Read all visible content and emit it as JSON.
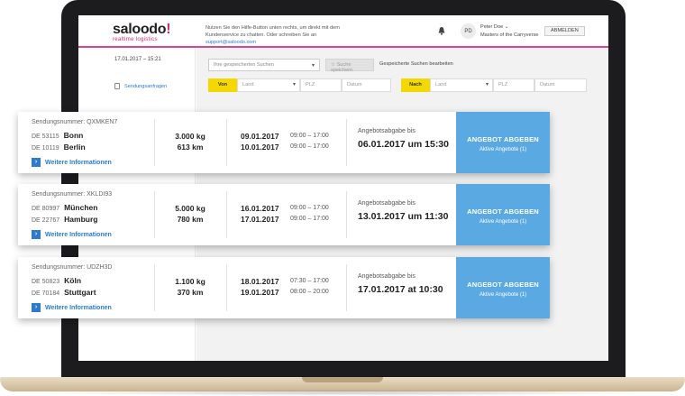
{
  "header": {
    "logo_main": "saloodo",
    "logo_dot": "!",
    "logo_sub": "realtime logistics",
    "help_text": "Nutzen Sie den Hilfe-Button unten rechts, um direkt mit dem Kundenservice zu chatten. Oder schreiben Sie an",
    "help_email": "support@saloodo.com",
    "avatar_initials": "PD",
    "user_name": "Peter Doe",
    "user_company": "Masters of the Carryverse",
    "logout_label": "ABMELDEN"
  },
  "sidebar": {
    "date": "17.01.2017 – 15:21",
    "items": [
      {
        "label": "Sendungsanfragen",
        "icon": "document-icon"
      }
    ]
  },
  "toolbar": {
    "saved_searches_placeholder": "Ihre gespeicherten Suchen",
    "save_search_label": "Suche speichern",
    "edit_searches_label": "Gespeicherte Suchen bearbeiten"
  },
  "filters": {
    "from": {
      "tag": "Von",
      "country": "Land",
      "zip": "PLZ",
      "date": "Datum"
    },
    "to": {
      "tag": "Nach",
      "country": "Land",
      "zip": "PLZ",
      "date": "Datum"
    }
  },
  "shipments": [
    {
      "number_label": "Sendungsnummer: QXMKEN7",
      "from_zip": "DE 53115",
      "from_city": "Bonn",
      "to_zip": "DE 10119",
      "to_city": "Berlin",
      "more_label": "Weitere Informationen",
      "weight": "3.000 kg",
      "distance": "613 km",
      "pickup_date": "09.01.2017",
      "pickup_time": "09:00 – 17:00",
      "delivery_date": "10.01.2017",
      "delivery_time": "09:00 – 17:00",
      "deadline_label": "Angebotsabgabe bis",
      "deadline": "06.01.2017 um 15:30",
      "cta_label": "ANGEBOT ABGEBEN",
      "cta_sub": "Aktive Angebote (1)"
    },
    {
      "number_label": "Sendungsnummer: XKLDI93",
      "from_zip": "DE 80997",
      "from_city": "München",
      "to_zip": "DE 22767",
      "to_city": "Hamburg",
      "more_label": "Weitere Informationen",
      "weight": "5.000 kg",
      "distance": "780 km",
      "pickup_date": "16.01.2017",
      "pickup_time": "09:00 – 17:00",
      "delivery_date": "17.01.2017",
      "delivery_time": "09:00 – 17:00",
      "deadline_label": "Angebotsabgabe bis",
      "deadline": "13.01.2017 um 11:30",
      "cta_label": "ANGEBOT ABGEBEN",
      "cta_sub": "Aktive Angebote (1)"
    },
    {
      "number_label": "Sendungsnummer: UDZH3D",
      "from_zip": "DE 50823",
      "from_city": "Köln",
      "to_zip": "DE 70184",
      "to_city": "Stuttgart",
      "more_label": "Weitere Informationen",
      "weight": "1.100 kg",
      "distance": "370 km",
      "pickup_date": "18.01.2017",
      "pickup_time": "07:30 – 17:00",
      "delivery_date": "19.01.2017",
      "delivery_time": "08:00 – 20:00",
      "deadline_label": "Angebotsabgabe bis",
      "deadline": "17.01.2017 at 10:30",
      "cta_label": "ANGEBOT ABGEBEN",
      "cta_sub": "Aktive Angebote (1)"
    }
  ],
  "colors": {
    "accent_blue": "#5aa9e2",
    "brand_pink": "#d6257c",
    "filter_yellow": "#f4d800",
    "link_blue": "#2a7bd1"
  }
}
